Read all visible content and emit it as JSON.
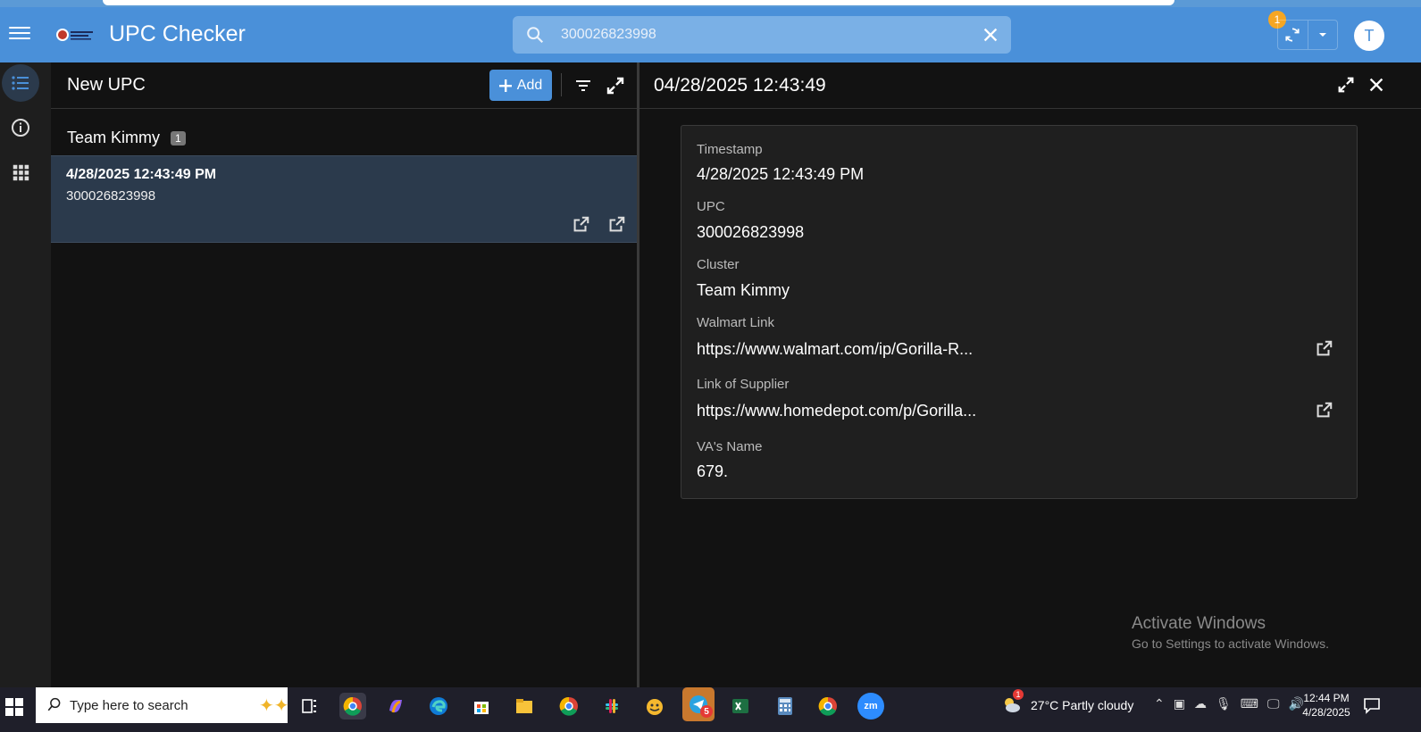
{
  "app": {
    "title": "UPC Checker",
    "sync_badge": "1",
    "avatar_initial": "T"
  },
  "search": {
    "value": "300026823998",
    "placeholder": "Search"
  },
  "list": {
    "title": "New UPC",
    "add_label": "Add",
    "group_name": "Team Kimmy",
    "group_count": "1",
    "items": [
      {
        "timestamp": "4/28/2025 12:43:49 PM",
        "upc": "300026823998"
      }
    ]
  },
  "detail": {
    "title": "04/28/2025 12:43:49",
    "fields": {
      "timestamp_label": "Timestamp",
      "timestamp_value": "4/28/2025 12:43:49 PM",
      "upc_label": "UPC",
      "upc_value": "300026823998",
      "cluster_label": "Cluster",
      "cluster_value": "Team Kimmy",
      "walmart_label": "Walmart Link",
      "walmart_value": "https://www.walmart.com/ip/Gorilla-R...",
      "supplier_label": "Link of Supplier",
      "supplier_value": "https://www.homedepot.com/p/Gorilla...",
      "va_label": "VA's Name",
      "va_value": "679."
    }
  },
  "watermark": {
    "line1": "Activate Windows",
    "line2": "Go to Settings to activate Windows."
  },
  "taskbar": {
    "search_text": "Type here to search",
    "weather": "27°C  Partly cloudy",
    "weather_badge": "1",
    "telegram_badge": "5",
    "time": "12:44 PM",
    "date": "4/28/2025"
  },
  "colors": {
    "appbar": "#4a90d9",
    "selected_row": "#2b3a4c",
    "background": "#121212",
    "badge": "#f5a623"
  }
}
